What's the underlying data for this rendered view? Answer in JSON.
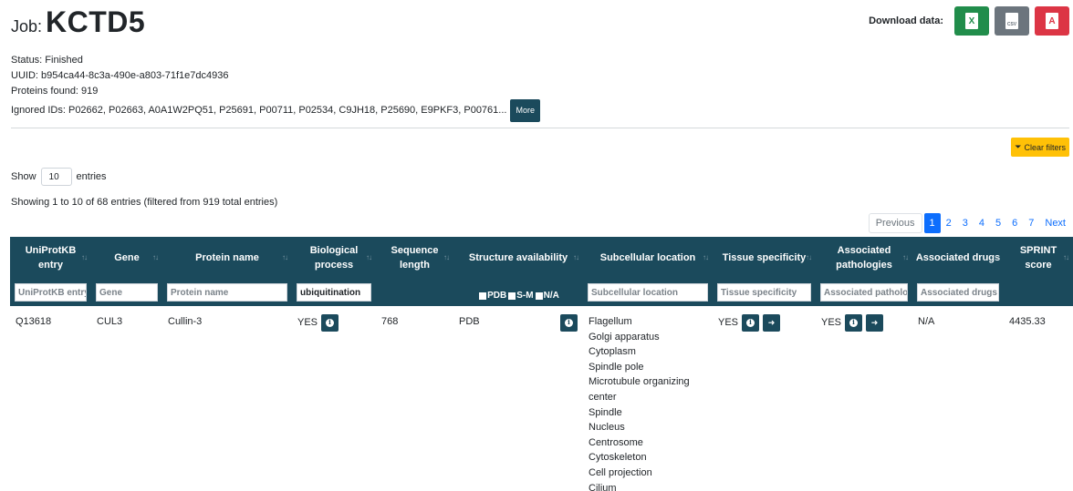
{
  "job": {
    "prefix": "Job:",
    "name": "KCTD5"
  },
  "download": {
    "label": "Download data:",
    "xlsx_glyph": "X",
    "csv_glyph": "CSV",
    "pdf_glyph": "A"
  },
  "meta": {
    "status": "Status: Finished",
    "uuid": "UUID: b954ca44-8c3a-490e-a803-71f1e7dc4936",
    "proteins": "Proteins found: 919",
    "ignored": "Ignored IDs: P02662, P02663, A0A1W2PQ51, P25691, P00711, P02534, C9JH18, P25690, E9PKF3, P00761...",
    "more_label": "More"
  },
  "clear_filters": "Clear filters",
  "length": {
    "show": "Show",
    "value": "10",
    "entries": "entries"
  },
  "info": "Showing 1 to 10 of 68 entries (filtered from 919 total entries)",
  "pagination": {
    "previous": "Previous",
    "pages": [
      "1",
      "2",
      "3",
      "4",
      "5",
      "6",
      "7"
    ],
    "next": "Next"
  },
  "columns": [
    "UniProtKB entry",
    "Gene",
    "Protein name",
    "Biological process",
    "Sequence length",
    "Structure availability",
    "Subcellular location",
    "Tissue specificity",
    "Associated pathologies",
    "Associated drugs",
    "SPRINT score"
  ],
  "filters": {
    "uniprot_ph": "UniProtKB entry",
    "gene_ph": "Gene",
    "protein_ph": "Protein name",
    "bio_value": "ubiquitination",
    "struct_options": [
      "PDB",
      "S-M",
      "N/A"
    ],
    "subcell_ph": "Subcellular location",
    "tissue_ph": "Tissue specificity",
    "patho_ph": "Associated pathologies",
    "drugs_ph": "Associated drugs"
  },
  "rows": [
    {
      "entry": "Q13618",
      "gene": "CUL3",
      "protein": "Cullin-3",
      "bio": "YES",
      "length": "768",
      "structure": "PDB",
      "subcell": [
        "Flagellum",
        "Golgi apparatus",
        "Cytoplasm",
        "Spindle pole",
        "Microtubule organizing center",
        "Spindle",
        "Nucleus",
        "Centrosome",
        "Cytoskeleton",
        "Cell projection",
        "Cilium"
      ],
      "tissue": "YES",
      "patho": "YES",
      "drugs": "N/A",
      "score": "4435.33"
    }
  ]
}
